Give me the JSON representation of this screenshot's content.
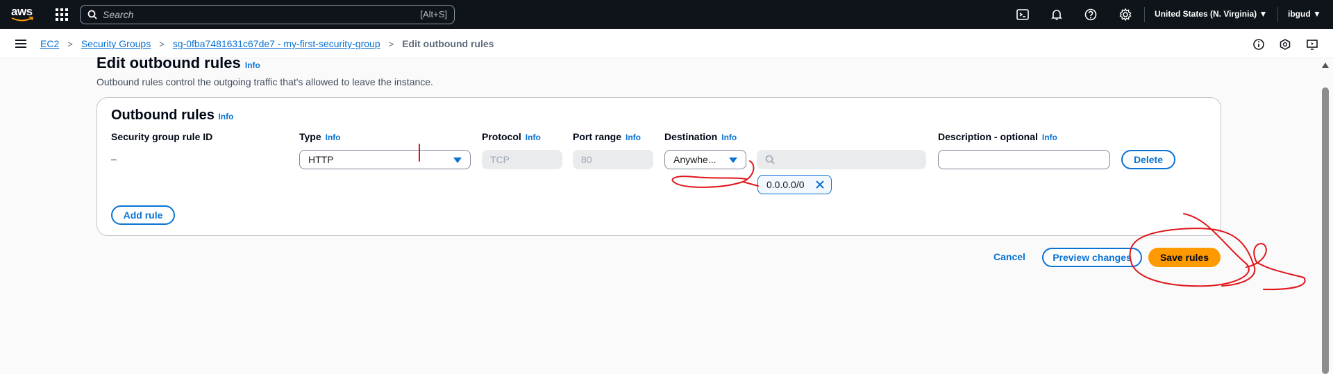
{
  "topnav": {
    "logo_text": "aws",
    "search_placeholder": "Search",
    "search_shortcut": "[Alt+S]",
    "region": "United States (N. Virginia)",
    "user": "ibgud"
  },
  "breadcrumb": {
    "items": [
      "EC2",
      "Security Groups",
      "sg-0fba7481631c67de7 - my-first-security-group"
    ],
    "current": "Edit outbound rules"
  },
  "page": {
    "title": "Edit outbound rules",
    "title_info": "Info",
    "description": "Outbound rules control the outgoing traffic that's allowed to leave the instance."
  },
  "panel": {
    "title": "Outbound rules",
    "title_info": "Info",
    "columns": {
      "rule_id": "Security group rule ID",
      "type": "Type",
      "protocol": "Protocol",
      "port_range": "Port range",
      "destination": "Destination",
      "description": "Description - optional"
    },
    "info_label": "Info",
    "rule": {
      "id": "–",
      "type": "HTTP",
      "protocol": "TCP",
      "port_range": "80",
      "destination": "Anywhe...",
      "cidr_token": "0.0.0.0/0",
      "description": ""
    },
    "delete_label": "Delete",
    "add_rule_label": "Add rule"
  },
  "actions": {
    "cancel": "Cancel",
    "preview": "Preview changes",
    "save": "Save rules"
  },
  "colors": {
    "link": "#0972d3",
    "primary": "#ff9900",
    "nav_bg": "#0f141a",
    "annotation": "#e0151b"
  }
}
